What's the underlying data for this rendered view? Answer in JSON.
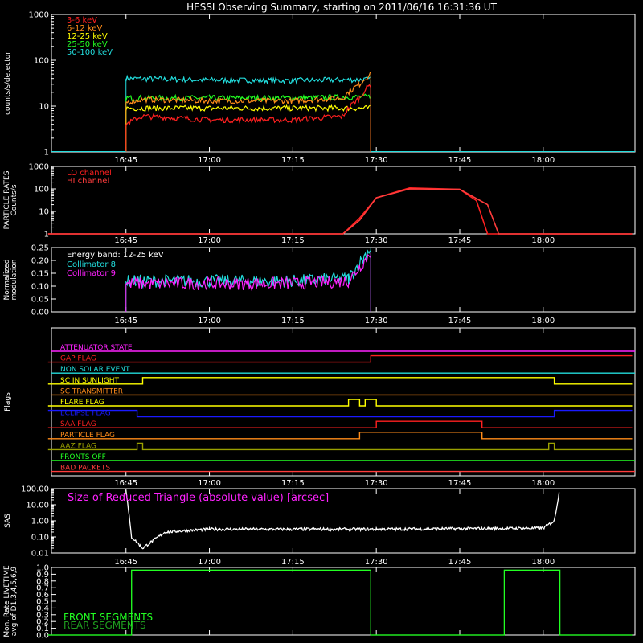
{
  "title": "HESSI Observing Summary, starting on 2011/06/16 16:31:36 UT",
  "time_ticks": [
    "16:45",
    "17:00",
    "17:15",
    "17:30",
    "17:45",
    "18:00"
  ],
  "colors": {
    "background": "#000000",
    "axes": "#ffffff",
    "red": "#ff2020",
    "orange": "#ff8c1a",
    "yellow": "#ffff00",
    "green": "#22ff22",
    "cyan": "#22dddd",
    "magenta": "#ff22ff",
    "blue": "#1a1aff",
    "flag_red": "#ff3c3c",
    "olive": "#9aa000",
    "dark_green": "#1fa01f"
  },
  "chart_data": [
    {
      "type": "line",
      "panel": "count_rates",
      "ylabel": "counts/s/detector",
      "yscale": "log",
      "ylim": [
        1,
        1000
      ],
      "y_ticks": [
        "1",
        "10",
        "100",
        "1000"
      ],
      "series": [
        {
          "name": "3-6 keV",
          "color": "red",
          "x": [
            "16:45",
            "16:48",
            "17:00",
            "17:15",
            "17:24",
            "17:27",
            "17:29"
          ],
          "values": [
            4,
            6,
            5,
            5,
            6,
            15,
            30
          ]
        },
        {
          "name": "6-12 keV",
          "color": "orange",
          "x": [
            "16:45",
            "16:48",
            "17:00",
            "17:15",
            "17:24",
            "17:27",
            "17:29"
          ],
          "values": [
            12,
            14,
            13,
            13,
            15,
            30,
            50
          ]
        },
        {
          "name": "12-25 keV",
          "color": "yellow",
          "x": [
            "16:45",
            "17:00",
            "17:15",
            "17:29"
          ],
          "values": [
            9,
            9,
            9,
            9
          ]
        },
        {
          "name": "25-50 keV",
          "color": "green",
          "x": [
            "16:45",
            "17:00",
            "17:15",
            "17:29"
          ],
          "values": [
            15,
            15,
            15,
            16
          ]
        },
        {
          "name": "50-100 keV",
          "color": "cyan",
          "x": [
            "16:45",
            "17:00",
            "17:15",
            "17:29"
          ],
          "values": [
            40,
            37,
            36,
            38
          ]
        }
      ]
    },
    {
      "type": "line",
      "panel": "particle_rates",
      "ylabel": [
        "PARTICLE RATES",
        "Counts/s"
      ],
      "yscale": "log",
      "ylim": [
        1,
        1000
      ],
      "y_ticks": [
        "1",
        "10",
        "100",
        "1000"
      ],
      "series": [
        {
          "name": "LO channel",
          "color": "red",
          "x": [
            "16:31",
            "17:24",
            "17:27",
            "17:30",
            "17:36",
            "17:45",
            "17:48",
            "17:50",
            "18:16"
          ],
          "values": [
            1,
            1,
            5,
            40,
            110,
            95,
            30,
            1,
            1
          ]
        },
        {
          "name": "HI channel",
          "color": "flag_red",
          "x": [
            "16:31",
            "17:24",
            "17:27",
            "17:30",
            "17:36",
            "17:45",
            "17:50",
            "17:52",
            "18:16"
          ],
          "values": [
            1,
            1,
            4,
            40,
            100,
            95,
            20,
            1,
            1
          ]
        }
      ]
    },
    {
      "type": "line",
      "panel": "modulation",
      "ylabel": [
        "Normalized",
        "modulation"
      ],
      "ylim": [
        0,
        0.25
      ],
      "y_ticks": [
        "0.00",
        "0.05",
        "0.10",
        "0.15",
        "0.20",
        "0.25"
      ],
      "annotation": "Energy band: 12-25 keV",
      "series": [
        {
          "name": "Collimator 8",
          "color": "cyan",
          "x": [
            "16:45",
            "17:00",
            "17:15",
            "17:25",
            "17:29"
          ],
          "values": [
            0.12,
            0.12,
            0.12,
            0.13,
            0.25
          ]
        },
        {
          "name": "Collimator 9",
          "color": "magenta",
          "x": [
            "16:45",
            "17:00",
            "17:15",
            "17:25",
            "17:29"
          ],
          "values": [
            0.11,
            0.11,
            0.11,
            0.12,
            0.23
          ]
        }
      ]
    },
    {
      "type": "line",
      "panel": "flags",
      "ylabel": "Flags",
      "series": [
        {
          "name": "ATTENUATOR STATE",
          "color": "magenta",
          "x": [],
          "values": []
        },
        {
          "name": "GAP FLAG",
          "color": "red",
          "x": [
            "16:31",
            "17:29",
            "17:29",
            "18:16"
          ],
          "values": [
            0,
            0,
            1,
            1
          ]
        },
        {
          "name": "NON SOLAR EVENT",
          "color": "cyan",
          "x": [],
          "values": []
        },
        {
          "name": "SC IN SUNLIGHT",
          "color": "yellow",
          "x": [
            "16:31",
            "16:48",
            "16:48",
            "18:02",
            "18:02",
            "18:16"
          ],
          "values": [
            0,
            0,
            1,
            1,
            0,
            0
          ]
        },
        {
          "name": "SC TRANSMITTER",
          "color": "orange",
          "x": [],
          "values": []
        },
        {
          "name": "FLARE FLAG",
          "color": "yellow",
          "x": [
            "16:31",
            "17:25",
            "17:25",
            "17:27",
            "17:27",
            "17:28",
            "17:28",
            "17:30",
            "17:30",
            "18:16"
          ],
          "values": [
            0,
            0,
            1,
            1,
            0,
            0,
            1,
            1,
            0,
            0
          ]
        },
        {
          "name": "ECLIPSE FLAG",
          "color": "blue",
          "x": [
            "16:31",
            "16:47",
            "16:47",
            "18:02",
            "18:02",
            "18:16"
          ],
          "values": [
            1,
            1,
            0,
            0,
            1,
            1
          ]
        },
        {
          "name": "SAA FLAG",
          "color": "red",
          "x": [
            "16:31",
            "17:30",
            "17:30",
            "17:49",
            "17:49",
            "18:16"
          ],
          "values": [
            0,
            0,
            1,
            1,
            0,
            0
          ]
        },
        {
          "name": "PARTICLE FLAG",
          "color": "orange",
          "x": [
            "16:31",
            "17:27",
            "17:27",
            "17:49",
            "17:49",
            "18:16"
          ],
          "values": [
            0,
            0,
            1,
            1,
            0,
            0
          ]
        },
        {
          "name": "AAZ FLAG",
          "color": "olive",
          "x": [
            "16:31",
            "16:47",
            "16:47",
            "16:48",
            "16:48",
            "18:01",
            "18:01",
            "18:02",
            "18:02",
            "18:16"
          ],
          "values": [
            0,
            0,
            1,
            1,
            0,
            0,
            1,
            1,
            0,
            0
          ]
        },
        {
          "name": "FRONTS OFF",
          "color": "green",
          "x": [],
          "values": []
        },
        {
          "name": "BAD PACKETS",
          "color": "flag_red",
          "x": [],
          "values": []
        }
      ]
    },
    {
      "type": "line",
      "panel": "sas",
      "ylabel": "SAS",
      "yscale": "log",
      "ylim": [
        0.01,
        100
      ],
      "y_ticks": [
        "0.01",
        "0.10",
        "1.00",
        "10.00",
        "100.00"
      ],
      "series": [
        {
          "name": "Size of Reduced Triangle (absolute value) [arcsec]",
          "color": "magenta",
          "x": [
            "16:45",
            "16:46",
            "16:48",
            "16:52",
            "17:00",
            "17:30",
            "18:00",
            "18:02",
            "18:03"
          ],
          "values": [
            100,
            0.1,
            0.02,
            0.2,
            0.3,
            0.3,
            0.35,
            1,
            100
          ]
        }
      ]
    },
    {
      "type": "line",
      "panel": "livetime",
      "ylabel": [
        "Mon. Rate LIVETIME",
        "avg of D1,3,4,5,6,9"
      ],
      "ylim": [
        0,
        1.0
      ],
      "y_ticks": [
        "0.0",
        "0.1",
        "0.2",
        "0.3",
        "0.4",
        "0.5",
        "0.6",
        "0.7",
        "0.8",
        "0.9",
        "1.0"
      ],
      "series": [
        {
          "name": "FRONT SEGMENTS",
          "color": "green",
          "x": [
            "16:31",
            "16:46",
            "16:46",
            "17:29",
            "17:29",
            "17:53",
            "17:53",
            "18:03",
            "18:03",
            "18:16"
          ],
          "values": [
            0,
            0,
            0.96,
            0.96,
            0,
            0,
            0.96,
            0.96,
            0,
            0
          ]
        },
        {
          "name": "REAR SEGMENTS",
          "color": "dark_green",
          "x": [
            "16:31",
            "16:46",
            "16:46",
            "17:29",
            "17:29",
            "17:53",
            "17:53",
            "18:03",
            "18:03",
            "18:16"
          ],
          "values": [
            0,
            0,
            0.96,
            0.96,
            0,
            0,
            0.96,
            0.96,
            0,
            0
          ]
        }
      ]
    }
  ]
}
